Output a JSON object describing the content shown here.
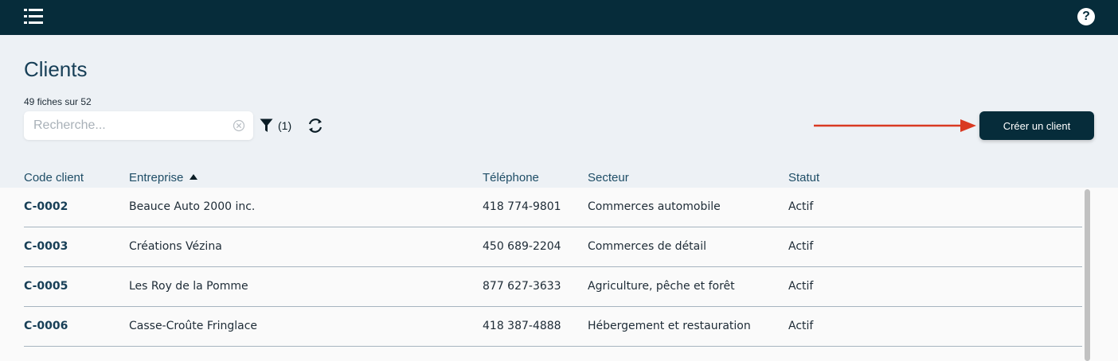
{
  "header": {
    "menu_icon": "list-icon",
    "help_icon": "question-circle-icon",
    "help_glyph": "?",
    "background": "#062c3a"
  },
  "page": {
    "title": "Clients",
    "count_text": "49 fiches sur 52"
  },
  "toolbar": {
    "search_placeholder": "Recherche...",
    "search_value": "",
    "clear_icon": "clear-circle-icon",
    "filter_icon": "funnel-icon",
    "filter_count": "(1)",
    "refresh_icon": "refresh-icon",
    "create_label": "Créer un client",
    "annotation_arrow_color": "#d93a22"
  },
  "table": {
    "columns": {
      "code": "Code client",
      "entreprise": "Entreprise",
      "telephone": "Téléphone",
      "secteur": "Secteur",
      "statut": "Statut"
    },
    "sort_column": "entreprise",
    "sort_direction": "ascending",
    "rows": [
      {
        "code": "C-0002",
        "entreprise": "Beauce Auto 2000 inc.",
        "telephone": "418 774-9801",
        "secteur": "Commerces automobile",
        "statut": "Actif"
      },
      {
        "code": "C-0003",
        "entreprise": "Créations Vézina",
        "telephone": "450 689-2204",
        "secteur": "Commerces de détail",
        "statut": "Actif"
      },
      {
        "code": "C-0005",
        "entreprise": "Les Roy de la Pomme",
        "telephone": "877 627-3633",
        "secteur": "Agriculture, pêche et forêt",
        "statut": "Actif"
      },
      {
        "code": "C-0006",
        "entreprise": "Casse-Croûte Fringlace",
        "telephone": "418 387-4888",
        "secteur": "Hébergement et restauration",
        "statut": "Actif"
      }
    ]
  }
}
